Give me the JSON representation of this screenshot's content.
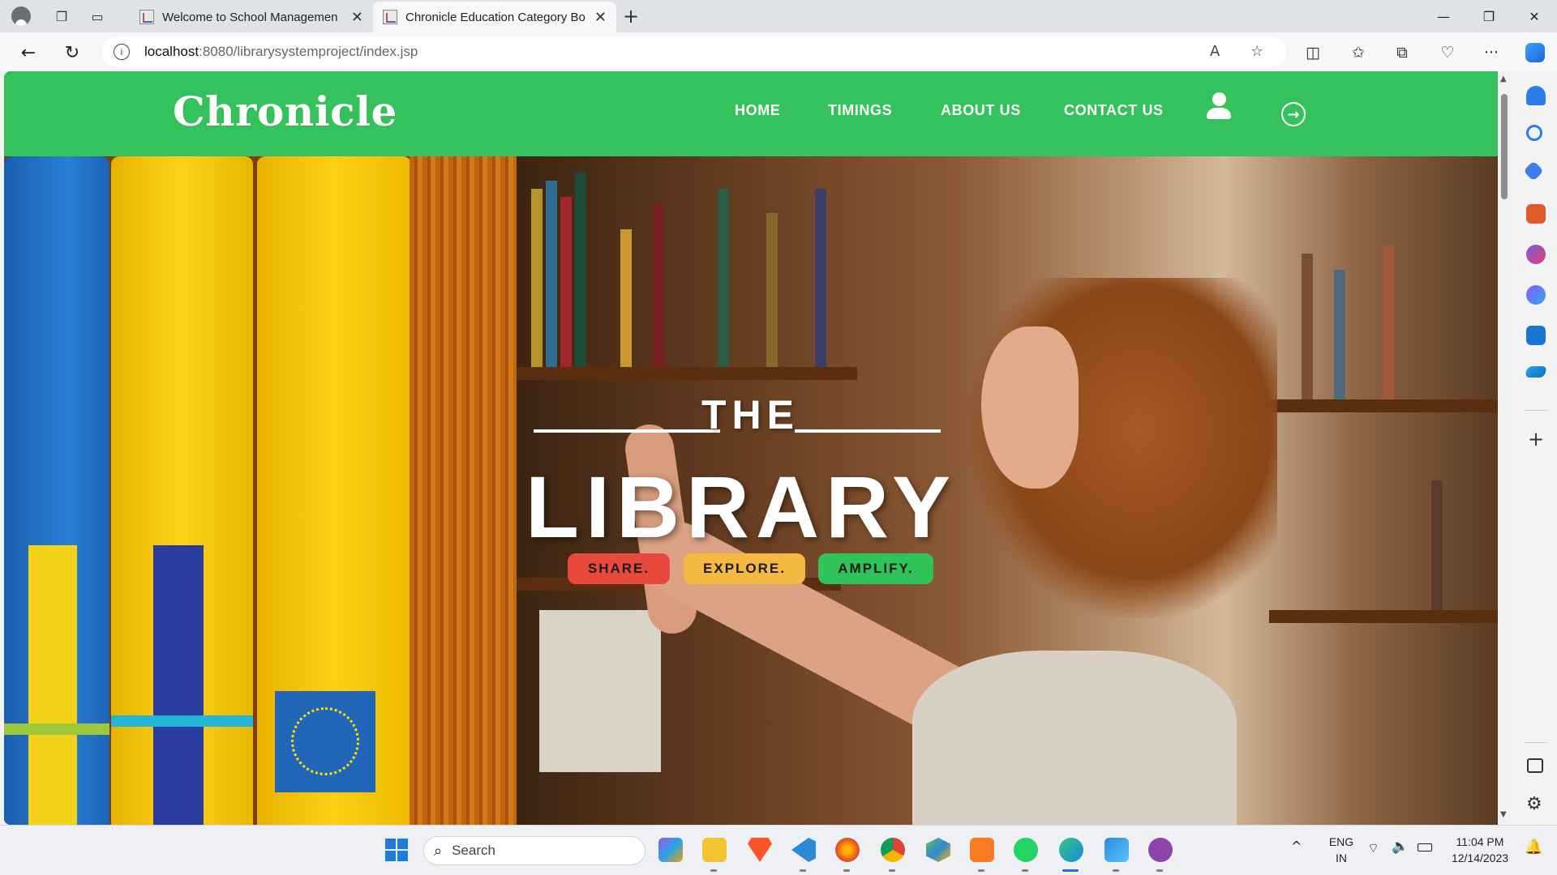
{
  "browser": {
    "tabs": [
      {
        "title": "Welcome to School Managemen",
        "active": false
      },
      {
        "title": "Chronicle Education Category Bo",
        "active": true
      }
    ],
    "url_host": "localhost",
    "url_path": ":8080/librarysystemproject/index.jsp"
  },
  "site": {
    "logo": "Chronicle",
    "nav": [
      "HOME",
      "TIMINGS",
      "ABOUT US",
      "CONTACT US"
    ],
    "hero": {
      "the": "THE",
      "library": "LIBRARY",
      "pills": [
        {
          "label": "SHARE.",
          "color": "#e8493c"
        },
        {
          "label": "EXPLORE.",
          "color": "#f5b942"
        },
        {
          "label": "AMPLIFY.",
          "color": "#2fc35a"
        }
      ]
    },
    "colors": {
      "header_green": "#35c25c"
    }
  },
  "taskbar": {
    "search_placeholder": "Search",
    "lang_top": "ENG",
    "lang_bottom": "IN",
    "time": "11:04 PM",
    "date": "12/14/2023"
  }
}
